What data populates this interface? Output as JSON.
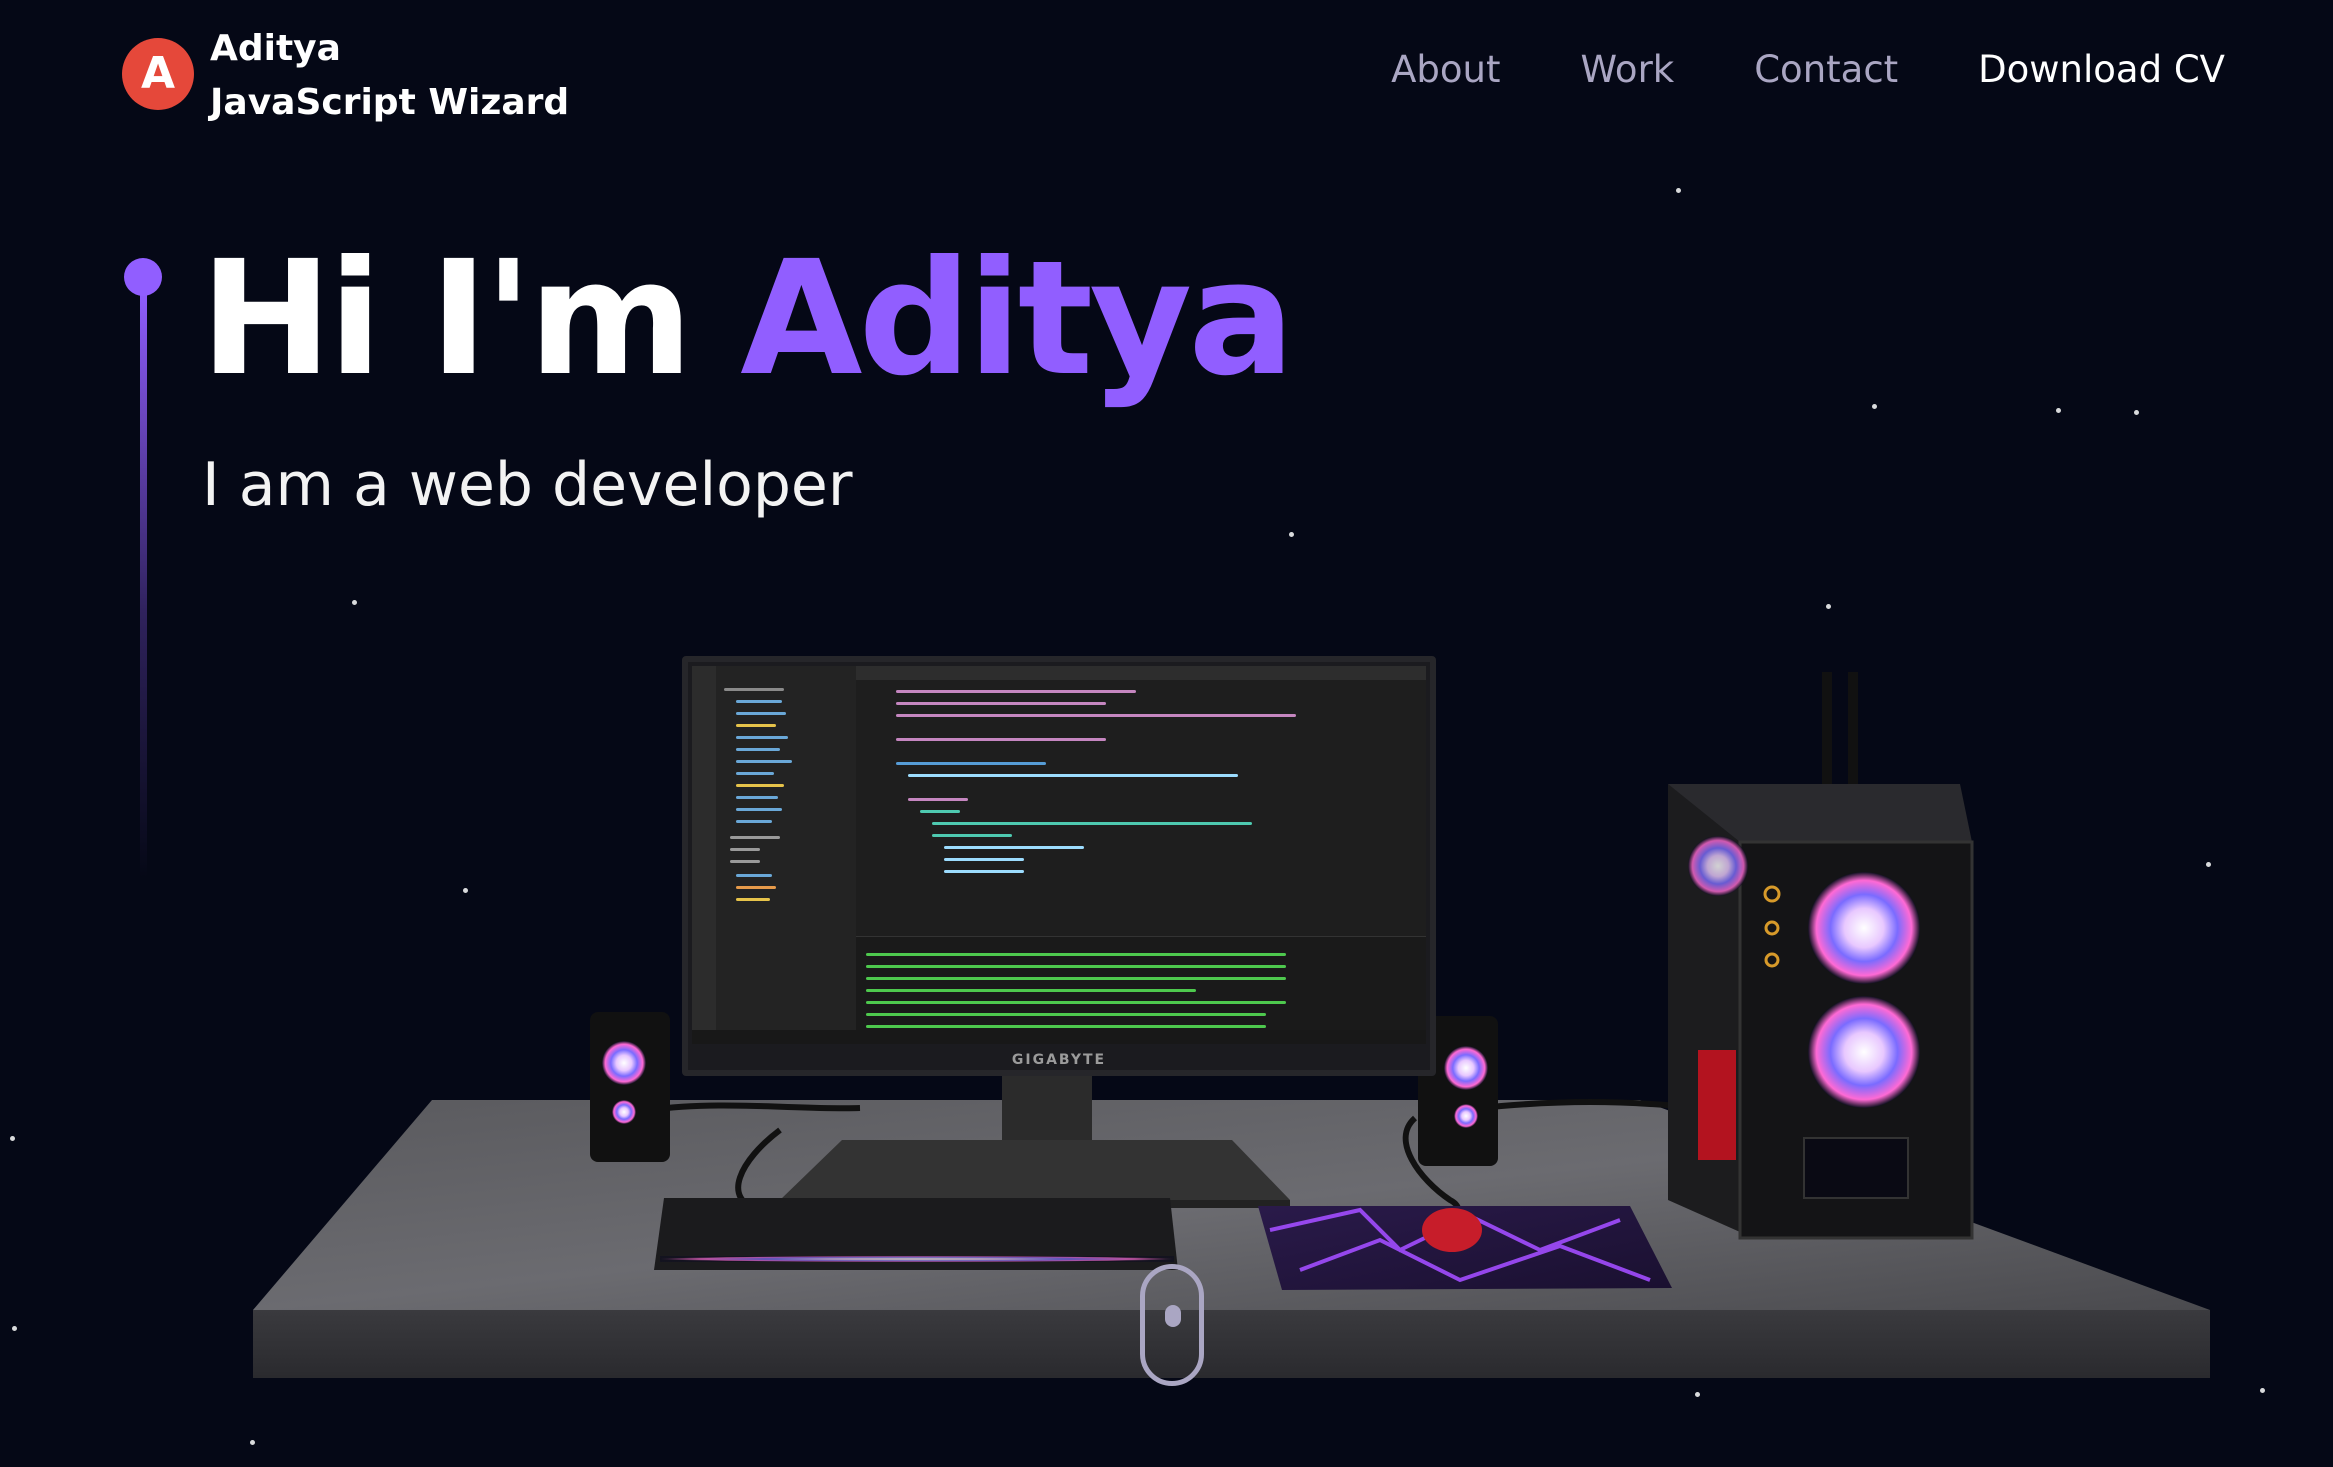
{
  "brand": {
    "name": "Aditya",
    "tagline": "JavaScript Wizard",
    "logo_glyph": "A",
    "logo_color": "#e5483a"
  },
  "nav": {
    "links": [
      "About",
      "Work",
      "Contact"
    ],
    "cta": "Download CV"
  },
  "hero": {
    "greeting": "Hi I'm ",
    "name": "Aditya",
    "subtitle": "I am a web developer",
    "accent_color": "#915eff",
    "background_color": "#050816"
  },
  "scene": {
    "monitor_brand": "GIGABYTE",
    "icons": [
      "monitor",
      "speaker",
      "keyboard",
      "mouse",
      "mousepad",
      "pc-case",
      "desk"
    ]
  },
  "scroll": {
    "icon": "mouse-scroll-icon"
  }
}
